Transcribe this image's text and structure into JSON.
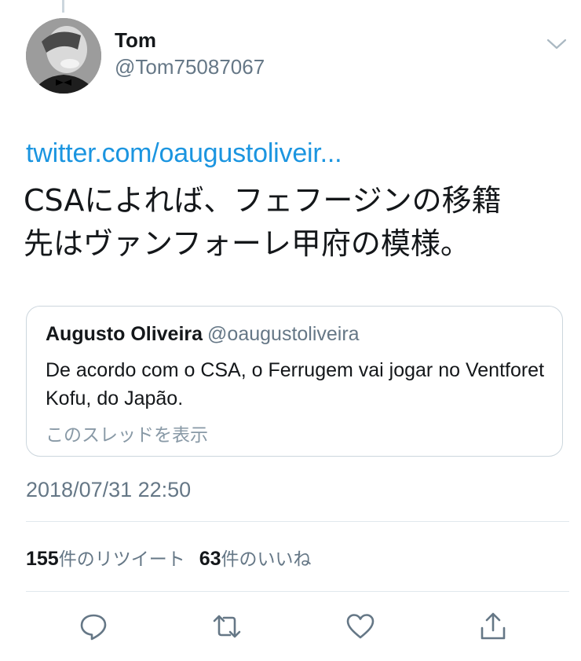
{
  "tweet": {
    "author": {
      "display_name": "Tom",
      "handle": "@Tom75087067"
    },
    "link": "twitter.com/oaugustoliveir...",
    "text_line1": "CSAによれば、フェフージンの移籍",
    "text_line2": "先はヴァンフォーレ甲府の模様。",
    "timestamp": "2018/07/31 22:50"
  },
  "quote": {
    "name": "Augusto Oliveira",
    "handle": "@oaugustoliveira",
    "text": "De acordo com o CSA, o Ferrugem vai jogar no Ventforet Kofu, do Japão.",
    "show_thread": "このスレッドを表示"
  },
  "stats": {
    "retweets_count": "155",
    "retweets_label": "件のリツイート",
    "likes_count": "63",
    "likes_label": "件のいいね"
  },
  "actions": {
    "reply_icon": "reply-icon",
    "retweet_icon": "retweet-icon",
    "like_icon": "heart-icon",
    "share_icon": "share-icon"
  },
  "colors": {
    "link": "#1b95e0",
    "secondary_text": "#657786",
    "border": "#ccd6dd",
    "icon": "#657786"
  }
}
